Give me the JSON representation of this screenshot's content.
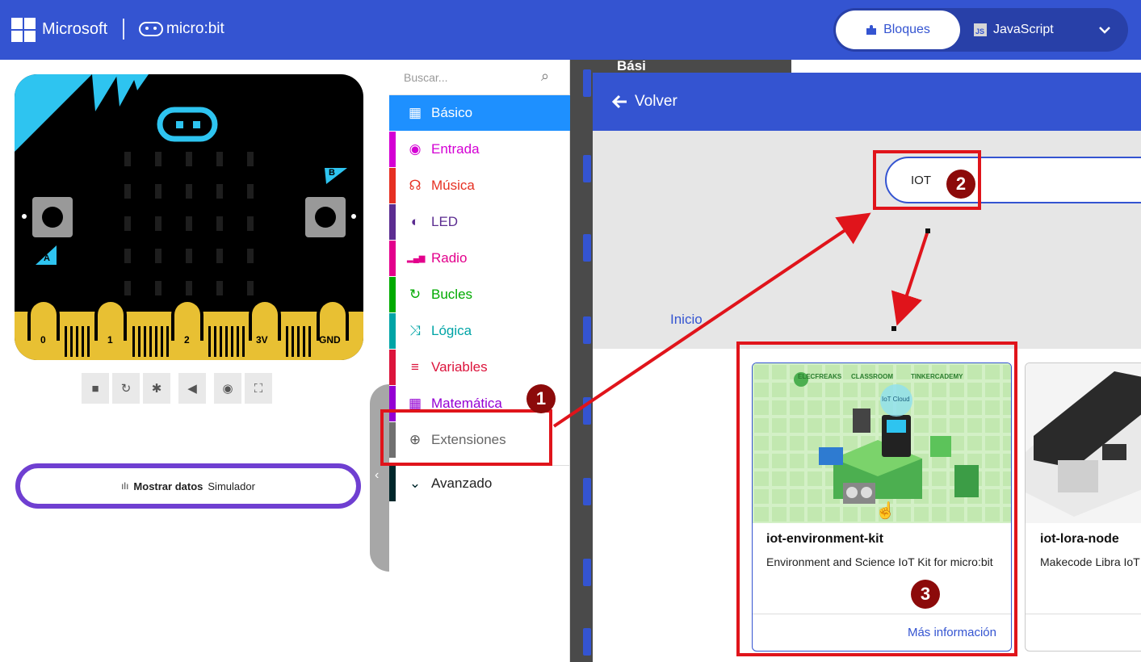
{
  "header": {
    "microsoft_label": "Microsoft",
    "product_label": "micro:bit",
    "blocks_label": "Bloques",
    "javascript_label": "JavaScript"
  },
  "simulator": {
    "pin_labels": [
      "0",
      "1",
      "2",
      "3V",
      "GND"
    ],
    "button_labels": [
      "A",
      "B"
    ],
    "tools": [
      "stop-icon",
      "restart-icon",
      "debug-icon",
      "mute-icon",
      "screenshot-icon",
      "fullscreen-icon"
    ],
    "showdata_bold": "Mostrar datos",
    "showdata_text": "Simulador"
  },
  "toolbox": {
    "search_placeholder": "Buscar...",
    "categories": [
      {
        "label": "Básico",
        "color": "#1e90ff",
        "icon": "grid-icon"
      },
      {
        "label": "Entrada",
        "color": "#d400d4",
        "icon": "target-icon"
      },
      {
        "label": "Música",
        "color": "#e63022",
        "icon": "headphones-icon"
      },
      {
        "label": "LED",
        "color": "#5c2d91",
        "icon": "toggle-icon"
      },
      {
        "label": "Radio",
        "color": "#e3008c",
        "icon": "signal-icon"
      },
      {
        "label": "Bucles",
        "color": "#00aa00",
        "icon": "loop-icon"
      },
      {
        "label": "Lógica",
        "color": "#00a4a6",
        "icon": "shuffle-icon"
      },
      {
        "label": "Variables",
        "color": "#dc143c",
        "icon": "lines-icon"
      },
      {
        "label": "Matemática",
        "color": "#9400d3",
        "icon": "calculator-icon"
      },
      {
        "label": "Extensiones",
        "color": "#707070",
        "icon": "plus-circle-icon"
      },
      {
        "label": "Avanzado",
        "color": "#00272b",
        "icon": "chevron-down-icon"
      }
    ]
  },
  "workspace": {
    "partial_label": "Bási"
  },
  "extensions": {
    "back_label": "Volver",
    "search_value": "IOT",
    "breadcrumb": "Inicio",
    "cards": [
      {
        "title": "iot-environment-kit",
        "description": "Environment and Science IoT Kit for micro:bit",
        "more": "Más información",
        "image_brands": [
          "ELECFREAKS",
          "CLASSROOM",
          "TINKERCADEMY"
        ],
        "image_cloud": "IoT Cloud"
      },
      {
        "title": "iot-lora-node",
        "description": "Makecode Libra IoT LoRa Node"
      }
    ]
  },
  "annotations": {
    "step1": "1",
    "step2": "2",
    "step3": "3",
    "color": "#e0141b"
  }
}
